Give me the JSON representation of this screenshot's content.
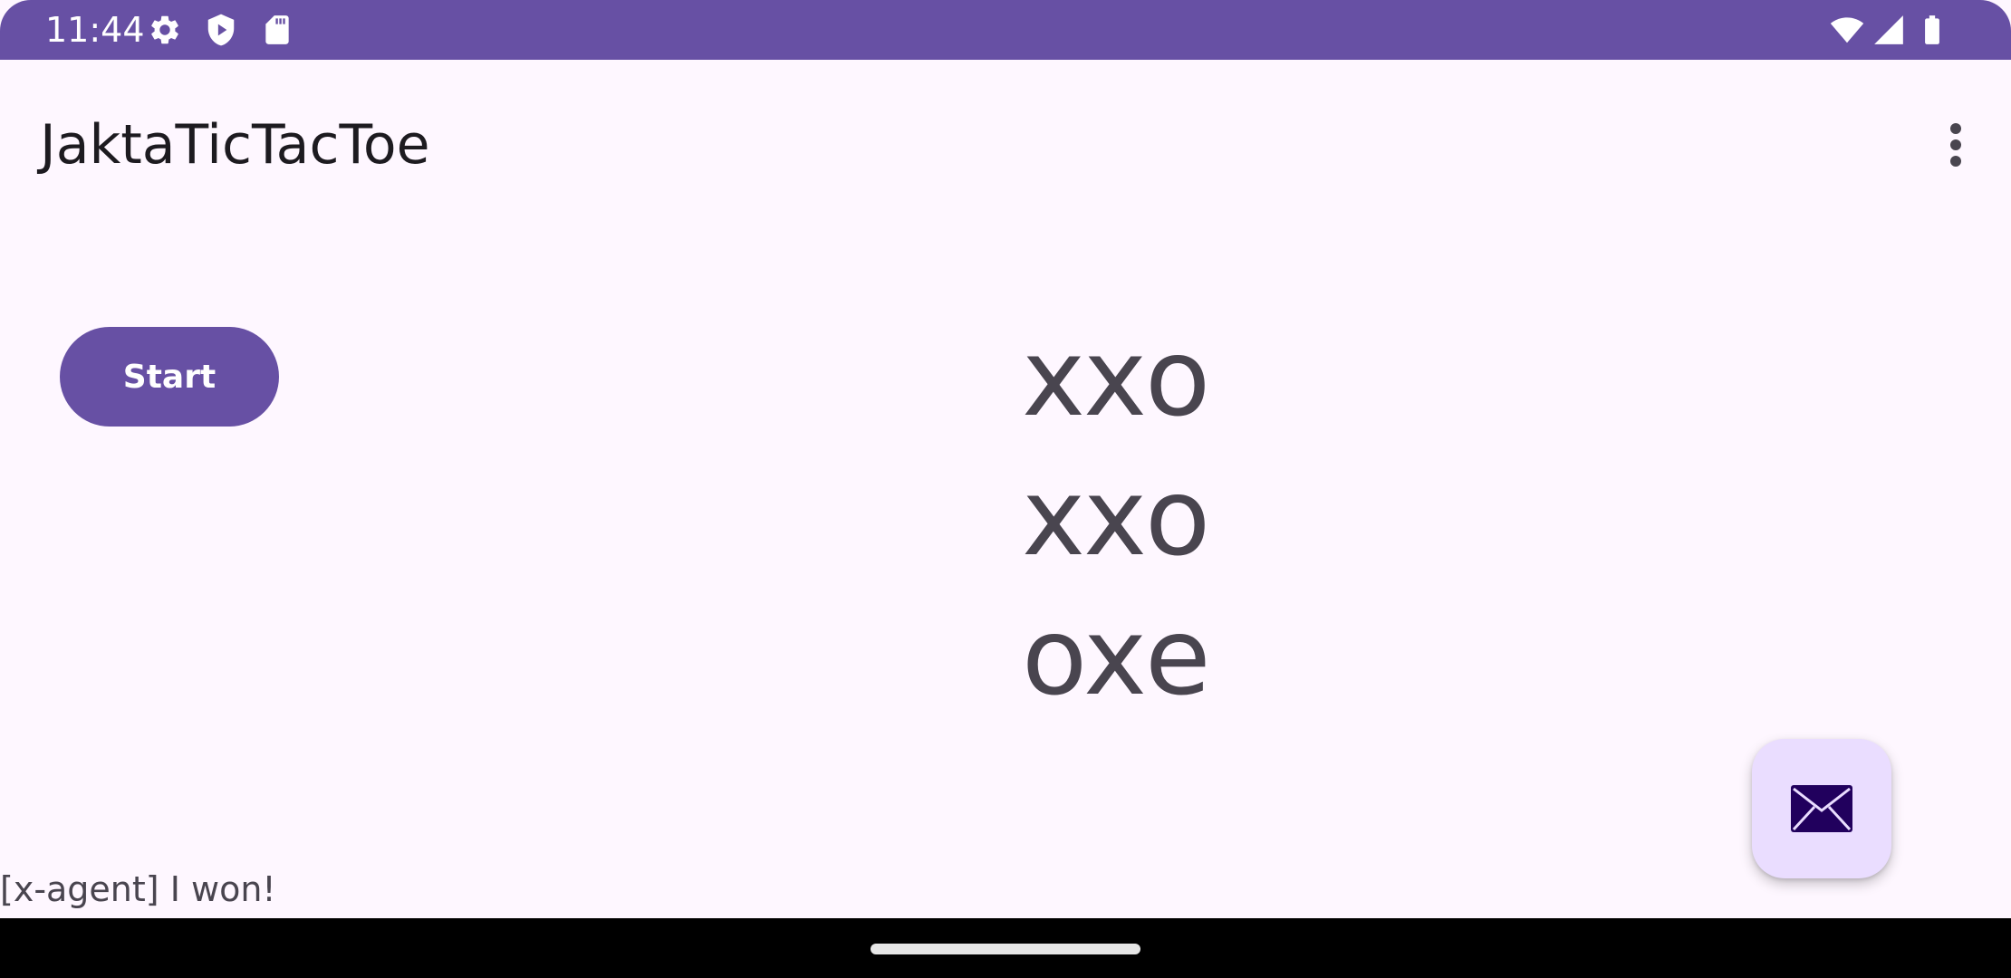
{
  "status_bar": {
    "time": "11:44",
    "left_icons": [
      "settings-icon",
      "shield-play-icon",
      "sd-card-icon"
    ],
    "right_icons": [
      "wifi-icon",
      "signal-icon",
      "battery-icon"
    ]
  },
  "app_bar": {
    "title": "JaktaTicTacToe",
    "overflow_icon": "more-vert-icon"
  },
  "controls": {
    "start_label": "Start"
  },
  "board": {
    "rows": [
      [
        "x",
        "x",
        "o"
      ],
      [
        "x",
        "x",
        "o"
      ],
      [
        "o",
        "x",
        "e"
      ]
    ]
  },
  "fab": {
    "icon": "mail-icon"
  },
  "message": "[x-agent] I won!",
  "colors": {
    "primary": "#6750a4",
    "background": "#fef7ff",
    "fab_container": "#eaddff",
    "board_text": "#49454f",
    "fab_icon": "#21005d"
  }
}
